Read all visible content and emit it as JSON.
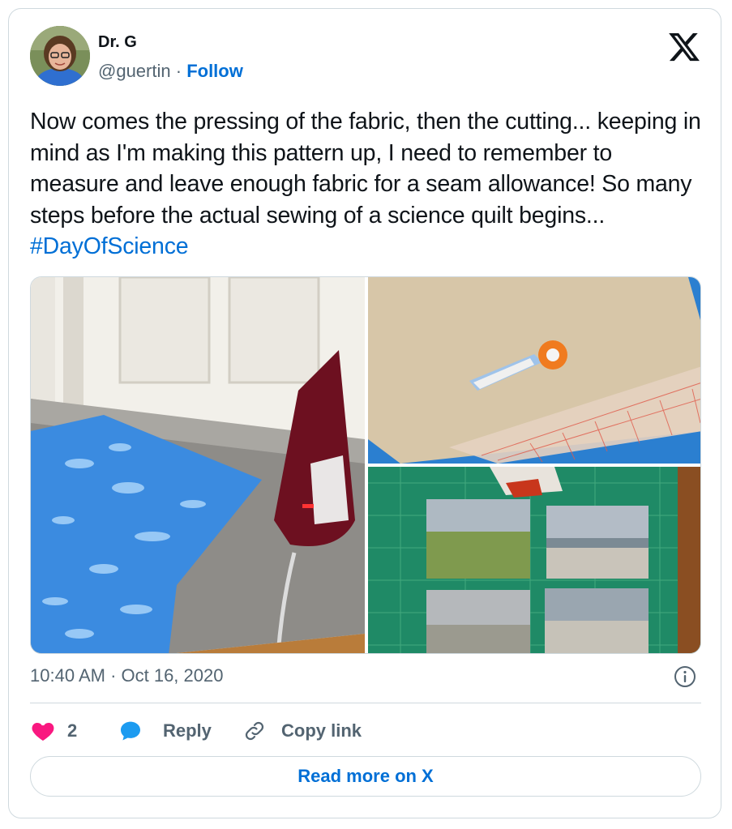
{
  "author": {
    "name": "Dr. G",
    "handle": "@guertin",
    "separator": "·",
    "follow_label": "Follow"
  },
  "tweet": {
    "text": "Now comes the pressing of the fabric, then the cutting... keeping in mind as I'm making this pattern up, I need to remember to measure and leave enough fabric for a seam allowance! So many steps before the actual sewing of a science quilt begins... ",
    "hashtag": "#DayOfScience",
    "timestamp": "10:40 AM · Oct 16, 2020"
  },
  "actions": {
    "likes_count": "2",
    "reply_label": "Reply",
    "copy_link_label": "Copy link"
  },
  "read_more_label": "Read more on X",
  "colors": {
    "link": "#006fd6",
    "heart": "#f91880",
    "reply_bubble": "#1d9bf0",
    "border": "#cfd9de",
    "muted": "#536471"
  },
  "icons": [
    "x-logo-icon",
    "info-icon",
    "heart-icon",
    "reply-bubble-icon",
    "link-icon"
  ]
}
